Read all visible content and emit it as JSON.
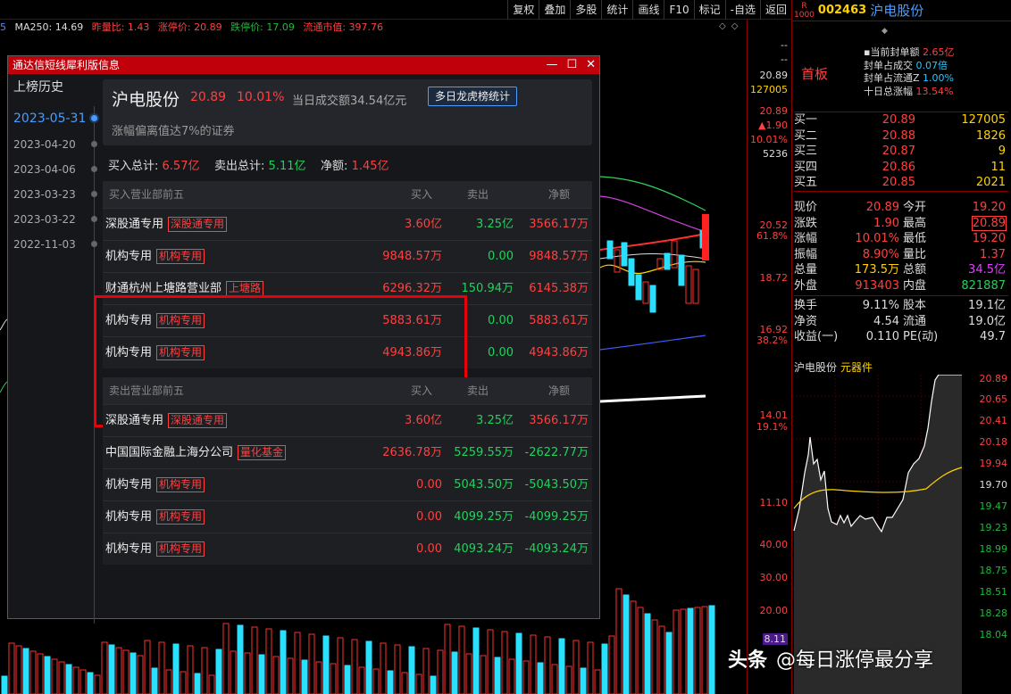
{
  "toolbar": {
    "buttons": [
      "复权",
      "叠加",
      "多股",
      "统计",
      "画线",
      "F10",
      "标记",
      "-自选",
      "返回"
    ]
  },
  "indicator": {
    "prefix": "5",
    "ma250": "MA250: 14.69",
    "zb": "昨量比: 1.43",
    "zt": "涨停价: 20.89",
    "dt": "跌停价: 17.09",
    "lt": "流通市值: 397.76"
  },
  "price_axis": {
    "labels": [
      "20.89",
      "127005",
      "20.89",
      "▲1.90",
      "10.01%",
      "5236",
      "20.52",
      "61.8%",
      "18.72",
      "16.92",
      "38.2%",
      "14.01",
      "19.1%",
      "11.10",
      "40.00",
      "30.00",
      "20.00",
      "8.11"
    ]
  },
  "popup": {
    "title": "通达信短线犀利版信息",
    "history_title": "上榜历史",
    "dates": [
      "2023-05-31",
      "2023-04-20",
      "2023-04-06",
      "2023-03-23",
      "2023-03-22",
      "2022-11-03"
    ],
    "stock_name": "沪电股份",
    "price": "20.89",
    "pct": "10.01%",
    "turnover": "当日成交额34.54亿元",
    "multi_day_button": "多日龙虎榜统计",
    "reason": "涨幅偏离值达7%的证券",
    "totals": {
      "buy_label": "买入总计:",
      "buy_value": "6.57亿",
      "sell_label": "卖出总计:",
      "sell_value": "5.11亿",
      "net_label": "净额:",
      "net_value": "1.45亿"
    },
    "buy_table": {
      "headers": [
        "买入营业部前五",
        "买入",
        "卖出",
        "净额"
      ],
      "rows": [
        {
          "name": "深股通专用",
          "tag": "深股通专用",
          "buy": "3.60亿",
          "sell": "3.25亿",
          "net": "3566.17万"
        },
        {
          "name": "机构专用",
          "tag": "机构专用",
          "buy": "9848.57万",
          "sell": "0.00",
          "net": "9848.57万"
        },
        {
          "name": "财通杭州上塘路营业部",
          "tag": "上塘路",
          "buy": "6296.32万",
          "sell": "150.94万",
          "net": "6145.38万"
        },
        {
          "name": "机构专用",
          "tag": "机构专用",
          "buy": "5883.61万",
          "sell": "0.00",
          "net": "5883.61万"
        },
        {
          "name": "机构专用",
          "tag": "机构专用",
          "buy": "4943.86万",
          "sell": "0.00",
          "net": "4943.86万"
        }
      ]
    },
    "sell_table": {
      "headers": [
        "卖出营业部前五",
        "买入",
        "卖出",
        "净额"
      ],
      "rows": [
        {
          "name": "深股通专用",
          "tag": "深股通专用",
          "buy": "3.60亿",
          "sell": "3.25亿",
          "net": "3566.17万"
        },
        {
          "name": "中国国际金融上海分公司",
          "tag": "量化基金",
          "buy": "2636.78万",
          "sell": "5259.55万",
          "net": "-2622.77万"
        },
        {
          "name": "机构专用",
          "tag": "机构专用",
          "buy": "0.00",
          "sell": "5043.50万",
          "net": "-5043.50万"
        },
        {
          "name": "机构专用",
          "tag": "机构专用",
          "buy": "0.00",
          "sell": "4099.25万",
          "net": "-4099.25万"
        },
        {
          "name": "机构专用",
          "tag": "机构专用",
          "buy": "0.00",
          "sell": "4093.24万",
          "net": "-4093.24万"
        }
      ]
    }
  },
  "right_panel": {
    "badge_top": "R",
    "badge_bottom": "1000",
    "code": "002463",
    "name": "沪电股份",
    "board": "首板",
    "seal": [
      {
        "label": "当前封单额",
        "value": "2.65亿",
        "color": "r"
      },
      {
        "label": "封单占成交",
        "value": "0.07倍",
        "color": "c"
      },
      {
        "label": "封单占流通Z",
        "value": "1.00%",
        "color": "c"
      },
      {
        "label": "十日总涨幅",
        "value": "13.54%",
        "color": "r"
      }
    ],
    "orderbook": [
      {
        "label": "买一",
        "price": "20.89",
        "vol": "127005"
      },
      {
        "label": "买二",
        "price": "20.88",
        "vol": "1826"
      },
      {
        "label": "买三",
        "price": "20.87",
        "vol": "9"
      },
      {
        "label": "买四",
        "price": "20.86",
        "vol": "11"
      },
      {
        "label": "买五",
        "price": "20.85",
        "vol": "2021"
      }
    ],
    "quote": {
      "xj": "现价",
      "xj_v": "20.89",
      "jk": "今开",
      "jk_v": "19.20",
      "zd": "涨跌",
      "zd_v": "1.90",
      "zg": "最高",
      "zg_v": "20.89",
      "zf": "涨幅",
      "zf_v": "10.01%",
      "zdi": "最低",
      "zdi_v": "19.20",
      "zhf": "振幅",
      "zhf_v": "8.90%",
      "lb": "量比",
      "lb_v": "1.37",
      "zl": "总量",
      "zl_v": "173.5万",
      "ze": "总额",
      "ze_v": "34.5亿",
      "wp": "外盘",
      "wp_v": "913403",
      "np": "内盘",
      "np_v": "821887",
      "hs": "换手",
      "hs_v": "9.11%",
      "gb": "股本",
      "gb_v": "19.1亿",
      "jz": "净资",
      "jz_v": "4.54",
      "lt": "流通",
      "lt_v": "19.0亿",
      "sy": "收益(一)",
      "sy_v": "0.110",
      "pe": "PE(动)",
      "pe_v": "49.7"
    },
    "mini_title_name": "沪电股份",
    "mini_title_tag": "元器件",
    "mini_axis": [
      "20.89",
      "20.65",
      "20.41",
      "20.18",
      "19.94",
      "19.70",
      "19.47",
      "19.23",
      "18.99",
      "18.75",
      "18.51",
      "18.28",
      "18.04"
    ]
  },
  "watermark": {
    "brand": "头条",
    "handle": "@每日涨停最分享"
  }
}
